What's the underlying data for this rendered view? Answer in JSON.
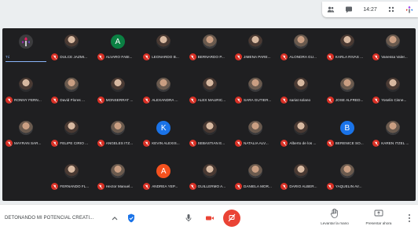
{
  "topbar": {
    "clock": "14:27",
    "icons": [
      "people-icon",
      "chat-icon",
      "activities-icon",
      "presenter-icon"
    ]
  },
  "meeting": {
    "title": "DETONANDO MI POTENCIAL CREATI..."
  },
  "self_label": "Tú",
  "actions": {
    "raise_hand": "Levantar la mano",
    "present": "Presentar ahora"
  },
  "colors": {
    "mute_red": "#d93025",
    "hangup_red": "#ea4335",
    "tile_bg": "#1f1f21"
  },
  "participants": [
    {
      "name": "Tú",
      "avatar": "logo"
    },
    {
      "name": "DULCE JAZMI...",
      "avatar": "photo"
    },
    {
      "name": "ALVARO FABI...",
      "avatar": "letter",
      "letter": "A",
      "color": "#0b8043"
    },
    {
      "name": "LEONARDO B...",
      "avatar": "photo"
    },
    {
      "name": "BERNARDO P...",
      "avatar": "photo2"
    },
    {
      "name": "JIMENA PARE...",
      "avatar": "photo"
    },
    {
      "name": "ALONDRA GU...",
      "avatar": "photo2"
    },
    {
      "name": "KARLA RIVAS ...",
      "avatar": "photo"
    },
    {
      "name": "Vanessa Valer...",
      "avatar": "photo2"
    },
    {
      "name": "RONNY FERN...",
      "avatar": "photo"
    },
    {
      "name": "David Flores ...",
      "avatar": "photo2"
    },
    {
      "name": "MONSERRAT ...",
      "avatar": "photo"
    },
    {
      "name": "ALEXANDRA ...",
      "avatar": "photo2"
    },
    {
      "name": "ALEX MAURIC...",
      "avatar": "photo"
    },
    {
      "name": "SARA GUTIER...",
      "avatar": "photo2"
    },
    {
      "name": "sariat solano",
      "avatar": "photo"
    },
    {
      "name": "JOSE ALFRED...",
      "avatar": "photo2"
    },
    {
      "name": "Yoselin Cisne...",
      "avatar": "photo"
    },
    {
      "name": "MAYRAN SAR...",
      "avatar": "photo2"
    },
    {
      "name": "FELIPE CIRIO ...",
      "avatar": "photo"
    },
    {
      "name": "ANGELES ITZ...",
      "avatar": "photo2"
    },
    {
      "name": "KEVIN ALEXIS...",
      "avatar": "letter",
      "letter": "K",
      "color": "#1a73e8"
    },
    {
      "name": "SEBASTIAN E...",
      "avatar": "photo"
    },
    {
      "name": "NATALIA ALV...",
      "avatar": "photo2"
    },
    {
      "name": "Alberto de los ...",
      "avatar": "photo"
    },
    {
      "name": "BERENICE SO...",
      "avatar": "letter",
      "letter": "B",
      "color": "#1a73e8"
    },
    {
      "name": "KAREN ITZEL ...",
      "avatar": "photo2"
    },
    {
      "name": "FERNANDO FL...",
      "avatar": "photo"
    },
    {
      "name": "Hector Manuel...",
      "avatar": "photo2"
    },
    {
      "name": "ANDREA YEP...",
      "avatar": "letter",
      "letter": "A",
      "color": "#f4511e"
    },
    {
      "name": "GUILLERMO A...",
      "avatar": "photo"
    },
    {
      "name": "DANIELA MOR...",
      "avatar": "photo2"
    },
    {
      "name": "DARIO ALBER...",
      "avatar": "photo"
    },
    {
      "name": "YAQUELIN AV...",
      "avatar": "photo2"
    }
  ]
}
